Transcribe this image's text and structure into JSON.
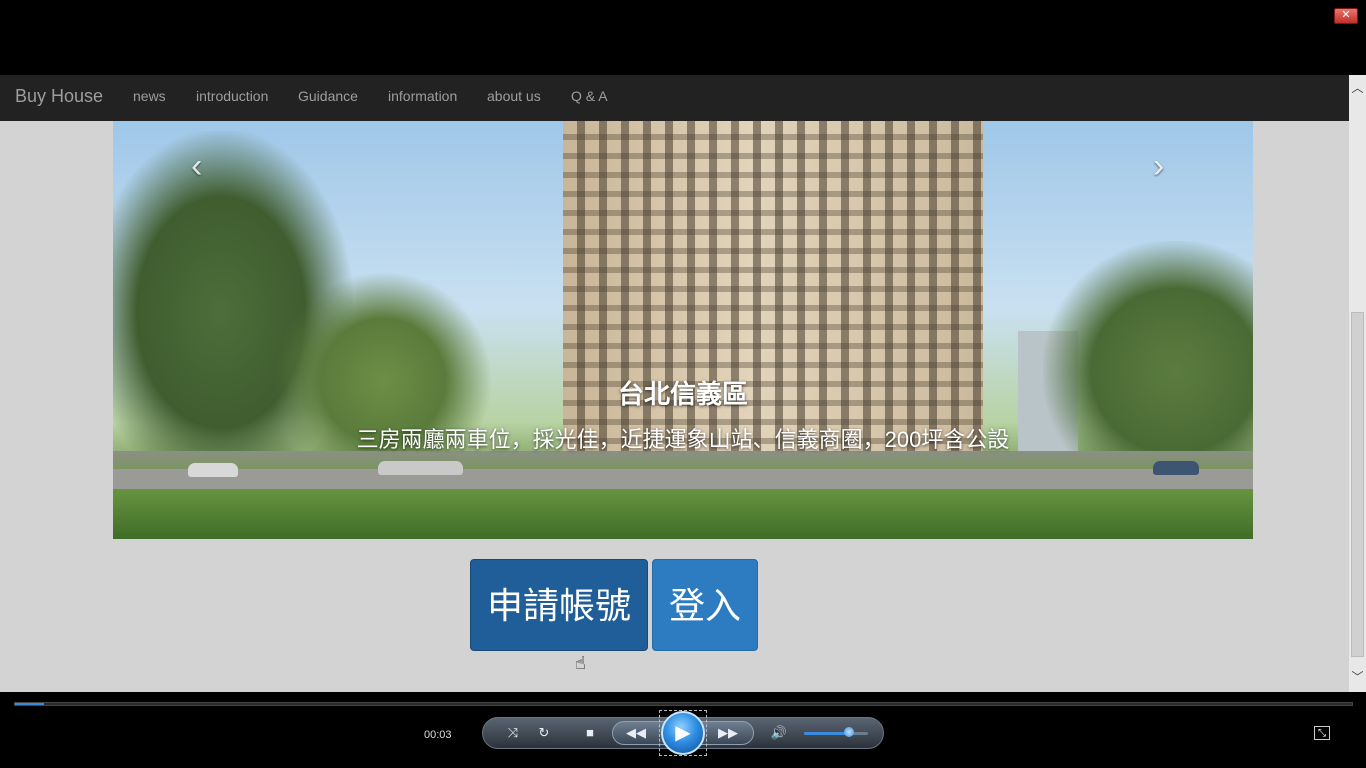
{
  "window": {
    "close_label": "✕"
  },
  "navbar": {
    "brand": "Buy House",
    "items": [
      {
        "label": "news"
      },
      {
        "label": "introduction"
      },
      {
        "label": "Guidance"
      },
      {
        "label": "information"
      },
      {
        "label": "about us"
      },
      {
        "label": "Q & A"
      }
    ]
  },
  "carousel": {
    "prev_icon": "‹",
    "next_icon": "›",
    "title": "台北信義區",
    "text": "三房兩廳兩車位，採光佳，近捷運象山站、信義商圈，200坪含公設",
    "slide_count": 4,
    "active_index": 0
  },
  "actions": {
    "register_label": "申請帳號",
    "login_label": "登入"
  },
  "player": {
    "time": "00:03",
    "progress": 0.022,
    "volume": 0.65,
    "icons": {
      "shuffle": "shuffle-icon",
      "repeat": "repeat-icon",
      "stop": "stop-icon",
      "rewind": "rewind-icon",
      "play": "play-icon",
      "fast_forward": "fast-forward-icon",
      "volume": "volume-icon",
      "switch": "switch-to-library-icon"
    }
  },
  "colors": {
    "navbar_bg": "#222222",
    "page_bg": "#d3d3d3",
    "register_btn": "#1f5e98",
    "login_btn": "#2d7cc1",
    "player_accent": "#3b8be0"
  }
}
